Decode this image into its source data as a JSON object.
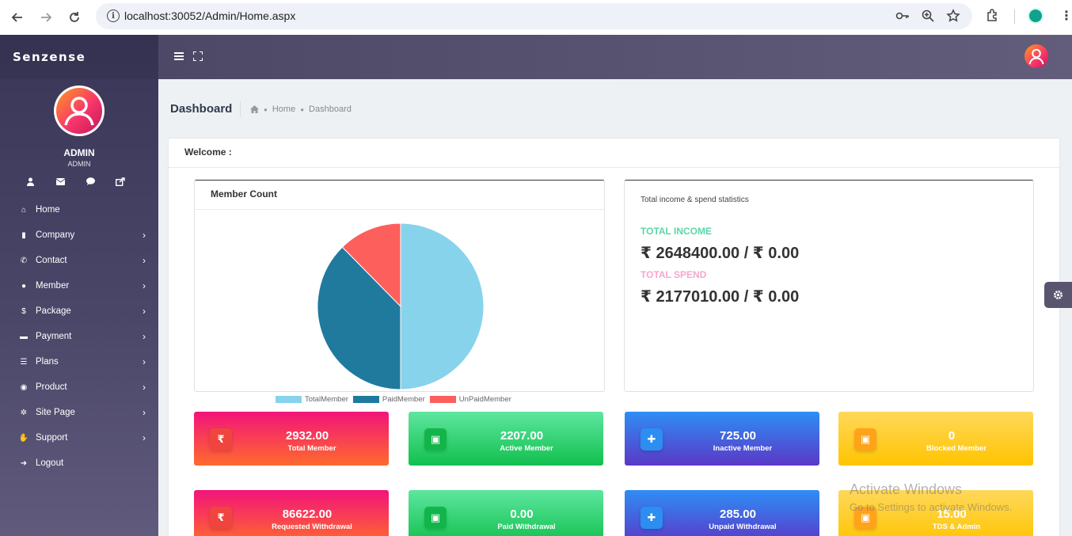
{
  "browser": {
    "url": "localhost:30052/Admin/Home.aspx"
  },
  "sidebar": {
    "brand": "Senzense",
    "user_name": "ADMIN",
    "user_role": "ADMIN",
    "items": [
      {
        "label": "Home",
        "icon": "home-icon",
        "glyph": "⌂",
        "chevron": false
      },
      {
        "label": "Company",
        "icon": "building-icon",
        "glyph": "▮",
        "chevron": true
      },
      {
        "label": "Contact",
        "icon": "phone-icon",
        "glyph": "✆",
        "chevron": true
      },
      {
        "label": "Member",
        "icon": "user-icon",
        "glyph": "●",
        "chevron": true
      },
      {
        "label": "Package",
        "icon": "dollar-icon",
        "glyph": "$",
        "chevron": true
      },
      {
        "label": "Payment",
        "icon": "wallet-icon",
        "glyph": "▬",
        "chevron": true
      },
      {
        "label": "Plans",
        "icon": "list-icon",
        "glyph": "☰",
        "chevron": true
      },
      {
        "label": "Product",
        "icon": "product-icon",
        "glyph": "◉",
        "chevron": true
      },
      {
        "label": "Site Page",
        "icon": "cogs-icon",
        "glyph": "✲",
        "chevron": true
      },
      {
        "label": "Support",
        "icon": "support-icon",
        "glyph": "✋",
        "chevron": true
      },
      {
        "label": "Logout",
        "icon": "logout-icon",
        "glyph": "➜",
        "chevron": false
      }
    ],
    "chevron_glyph": "›"
  },
  "page": {
    "title": "Dashboard",
    "breadcrumb": [
      "Home",
      "Dashboard"
    ],
    "welcome": "Welcome :"
  },
  "member_chart": {
    "title": "Member Count"
  },
  "chart_data": {
    "type": "pie",
    "categories": [
      "TotalMember",
      "PaidMember",
      "UnPaidMember"
    ],
    "values": [
      2932,
      2207,
      725
    ],
    "colors": [
      "#87d3ec",
      "#1f7a9e",
      "#fc5f5c"
    ],
    "legend": "bottom"
  },
  "stats": {
    "subtitle": "Total income & spend statistics",
    "income_label": "TOTAL INCOME",
    "income_value": "₹ 2648400.00 / ₹ 0.00",
    "income_color": "#5cd6a6",
    "spend_label": "TOTAL SPEND",
    "spend_value": "₹ 2177010.00 / ₹ 0.00",
    "spend_color": "#f7a6d0"
  },
  "tiles": [
    {
      "value": "2932.00",
      "label": "Total Member",
      "icon": "rupee-icon",
      "glyph": "₹",
      "color": "red"
    },
    {
      "value": "2207.00",
      "label": "Active Member",
      "icon": "money-icon",
      "glyph": "▣",
      "color": "green"
    },
    {
      "value": "725.00",
      "label": "Inactive Member",
      "icon": "user-plus-icon",
      "glyph": "✚",
      "color": "blue"
    },
    {
      "value": "0",
      "label": "Blocked Member",
      "icon": "money-icon",
      "glyph": "▣",
      "color": "yellow"
    },
    {
      "value": "86622.00",
      "label": "Requested Withdrawal",
      "icon": "rupee-icon",
      "glyph": "₹",
      "color": "red"
    },
    {
      "value": "0.00",
      "label": "Paid Withdrawal",
      "icon": "money-icon",
      "glyph": "▣",
      "color": "green"
    },
    {
      "value": "285.00",
      "label": "Unpaid Withdrawal",
      "icon": "user-plus-icon",
      "glyph": "✚",
      "color": "blue"
    },
    {
      "value": "15.00",
      "label": "TDS & Admin",
      "icon": "money-icon",
      "glyph": "▣",
      "color": "yellow"
    }
  ],
  "watermark": {
    "line1": "Activate Windows",
    "line2": "Go to Settings to activate Windows."
  }
}
